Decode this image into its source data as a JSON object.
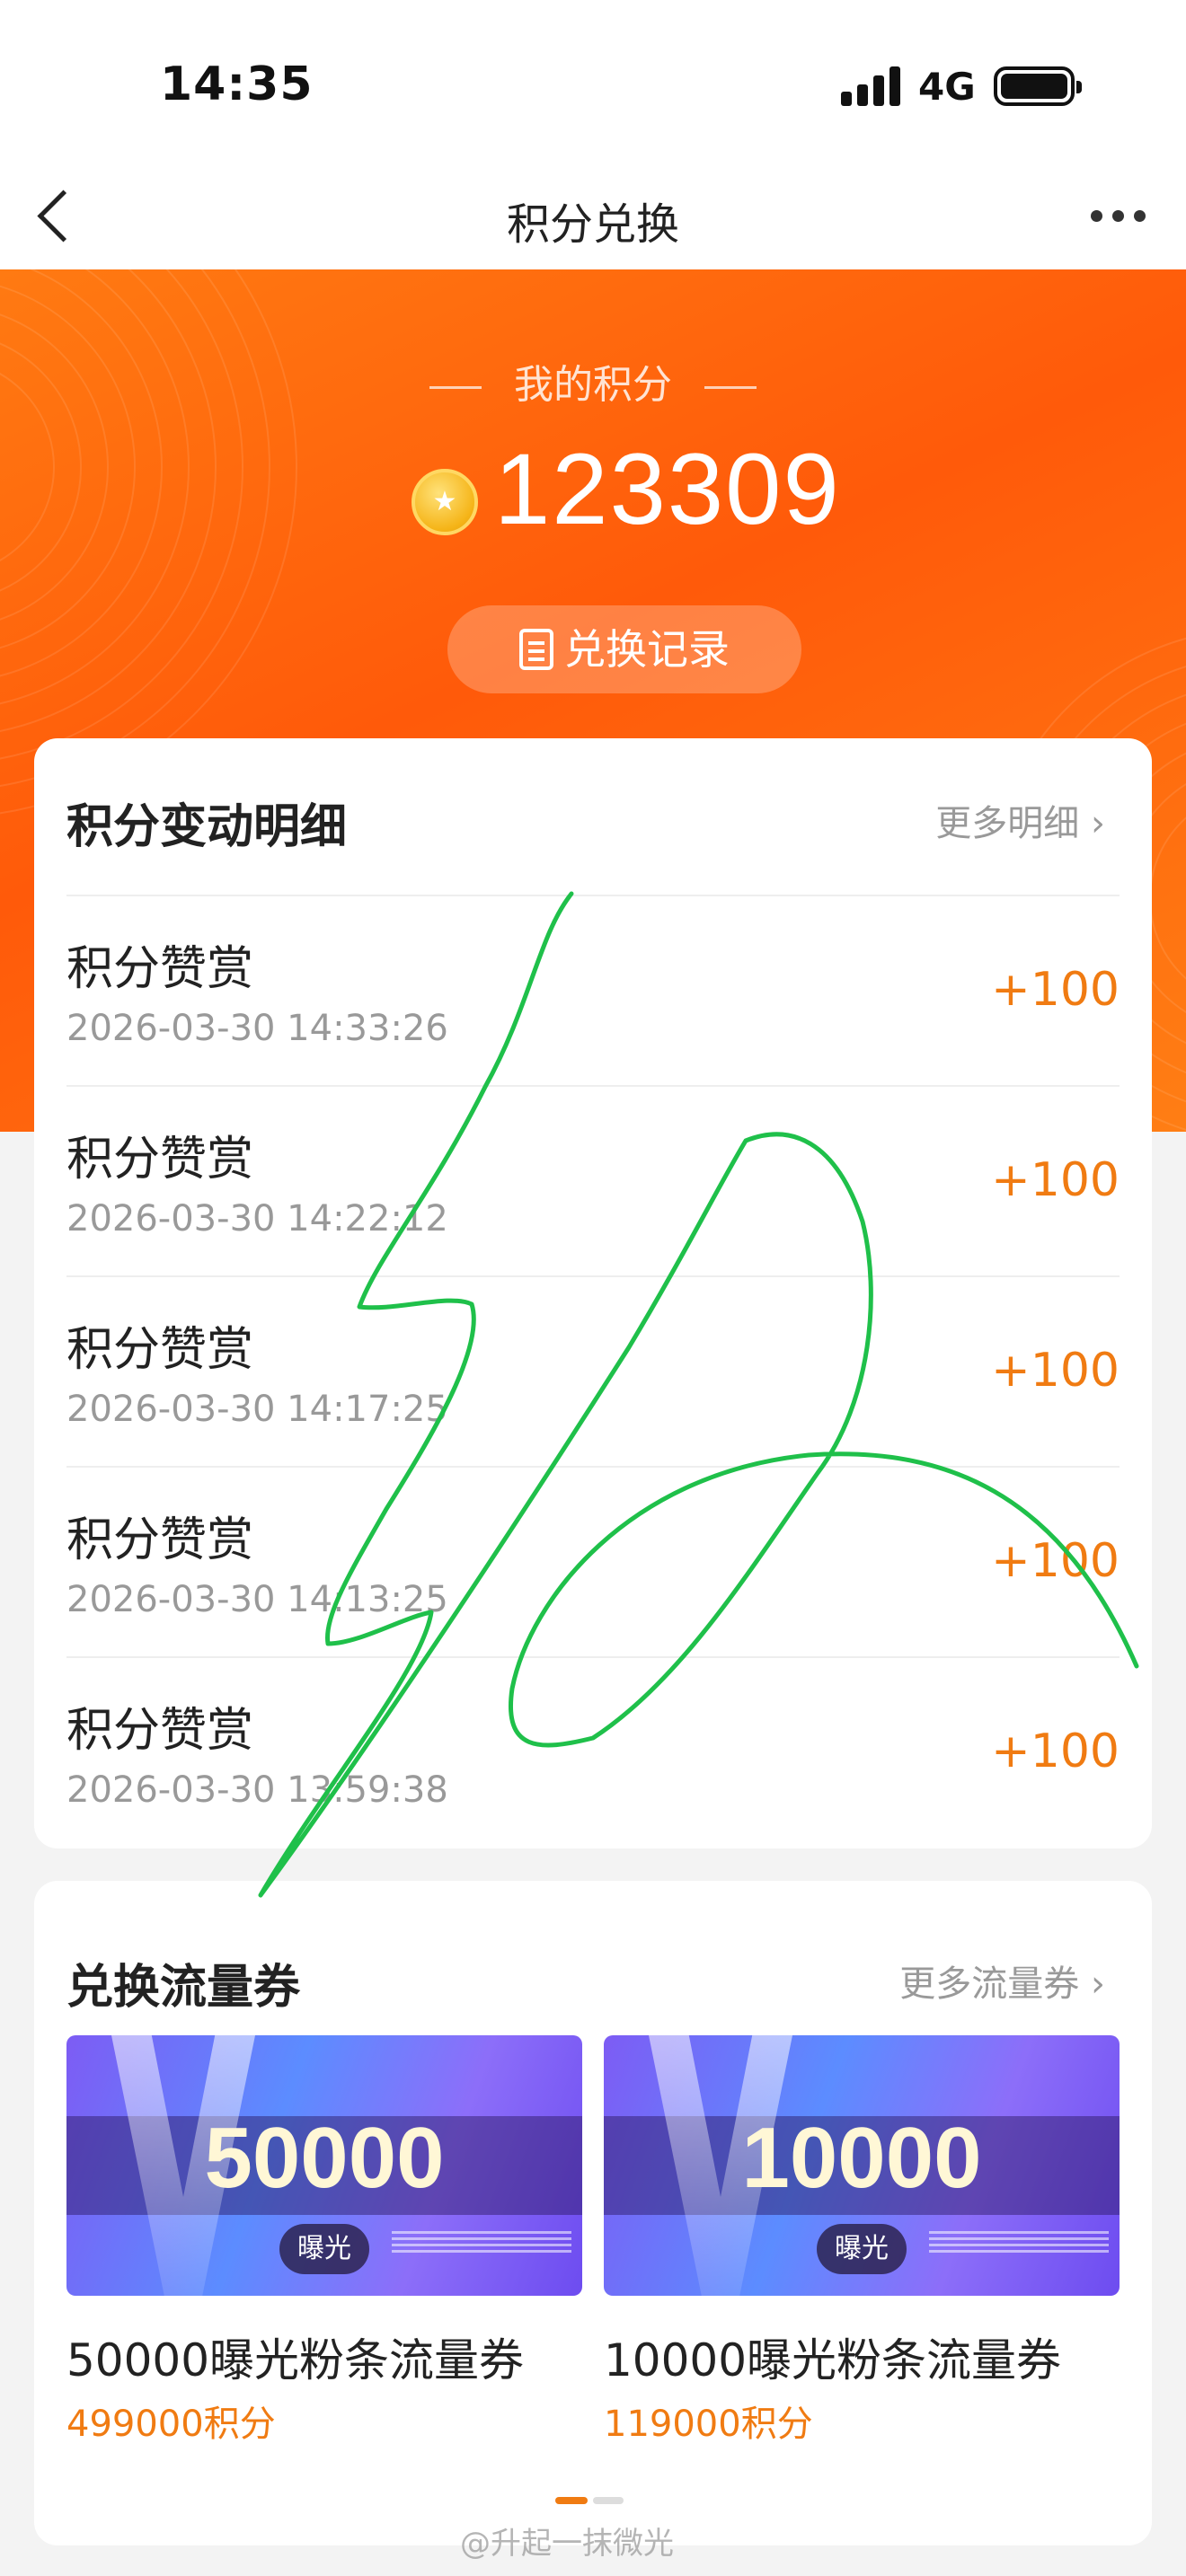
{
  "status_bar": {
    "time": "14:35",
    "network": "4G"
  },
  "nav": {
    "title": "积分兑换",
    "back_icon": "chevron-left-icon",
    "more_icon": "more-dots-icon"
  },
  "hero": {
    "label": "我的积分",
    "points": "123309",
    "record_button": "兑换记录",
    "colors": {
      "start": "#ff7a12",
      "end": "#ff5a0a"
    }
  },
  "details": {
    "title": "积分变动明细",
    "more": "更多明细 ›",
    "rows": [
      {
        "label": "积分赞赏",
        "date": "2026-03-30 14:33:26",
        "amount": "+100"
      },
      {
        "label": "积分赞赏",
        "date": "2026-03-30 14:22:12",
        "amount": "+100"
      },
      {
        "label": "积分赞赏",
        "date": "2026-03-30 14:17:25",
        "amount": "+100"
      },
      {
        "label": "积分赞赏",
        "date": "2026-03-30 14:13:25",
        "amount": "+100"
      },
      {
        "label": "积分赞赏",
        "date": "2026-03-30 13:59:38",
        "amount": "+100"
      }
    ]
  },
  "coupons": {
    "title": "兑换流量券",
    "more": "更多流量券 ›",
    "items": [
      {
        "amount": "50000",
        "tag": "曝光",
        "name": "50000曝光粉条流量券",
        "price": "499000积分"
      },
      {
        "amount": "10000",
        "tag": "曝光",
        "name": "10000曝光粉条流量券",
        "price": "119000积分"
      }
    ]
  },
  "watermark": "@升起一抹微光",
  "accent_color": "#f07b12",
  "annotation_color": "#1fc04a"
}
